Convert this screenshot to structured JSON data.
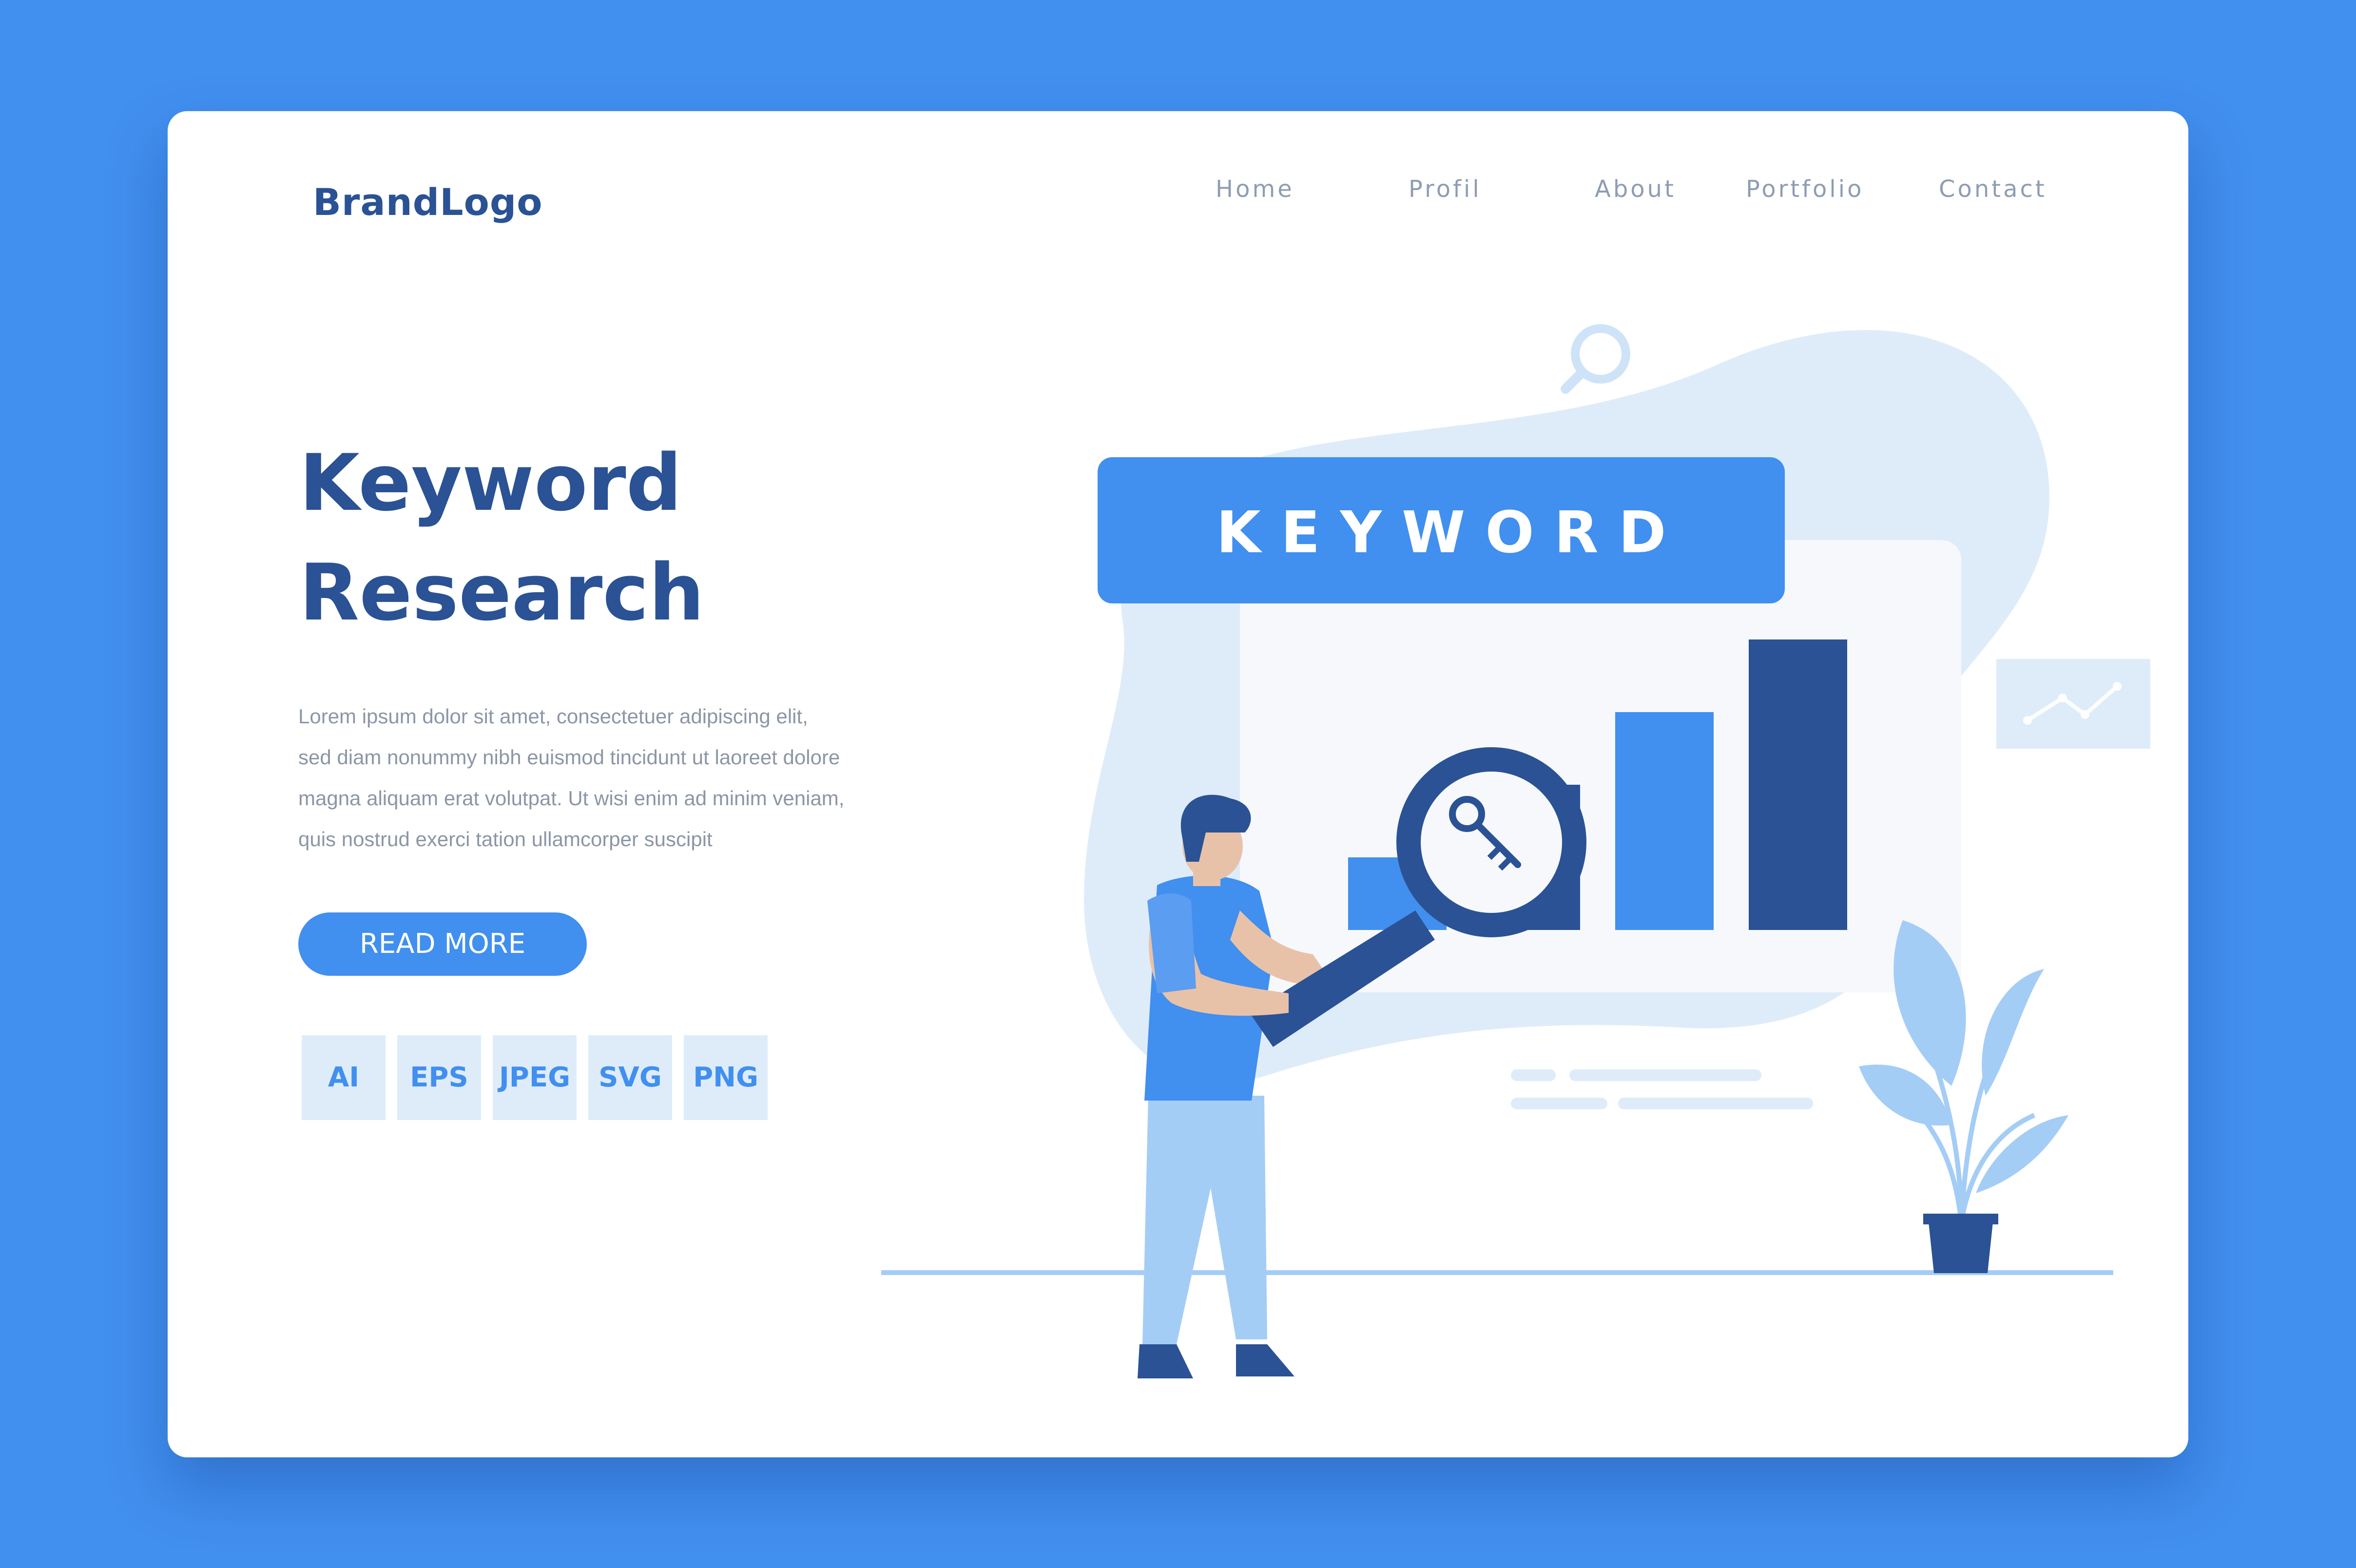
{
  "brand": {
    "logo_text": "BrandLogo"
  },
  "nav": {
    "items": [
      {
        "label": "Home"
      },
      {
        "label": "Profil"
      },
      {
        "label": "About"
      },
      {
        "label": "Portfolio"
      },
      {
        "label": "Contact"
      }
    ]
  },
  "hero": {
    "title_line1": "Keyword",
    "title_line2": "Research",
    "body_lines": [
      "Lorem ipsum dolor sit amet, consectetuer adipiscing elit,",
      "sed diam nonummy nibh euismod tincidunt ut laoreet dolore",
      "magna aliquam erat volutpat. Ut wisi enim ad minim veniam,",
      "quis nostrud exerci tation ullamcorper suscipit"
    ],
    "cta_label": "READ MORE"
  },
  "formats": [
    "AI",
    "EPS",
    "JPEG",
    "SVG",
    "PNG"
  ],
  "illustration": {
    "banner_text": "K E Y W O R D",
    "bar_chart": {
      "type": "bar",
      "values": [
        1,
        2,
        3,
        4
      ]
    },
    "colors": {
      "primary": "#418fef",
      "dark": "#2a5294",
      "light": "#deecfa",
      "pale": "#a4cdf6"
    },
    "icons": [
      "search-icon",
      "key-icon",
      "magnifier-icon",
      "trend-chart-icon",
      "plant-icon"
    ]
  }
}
